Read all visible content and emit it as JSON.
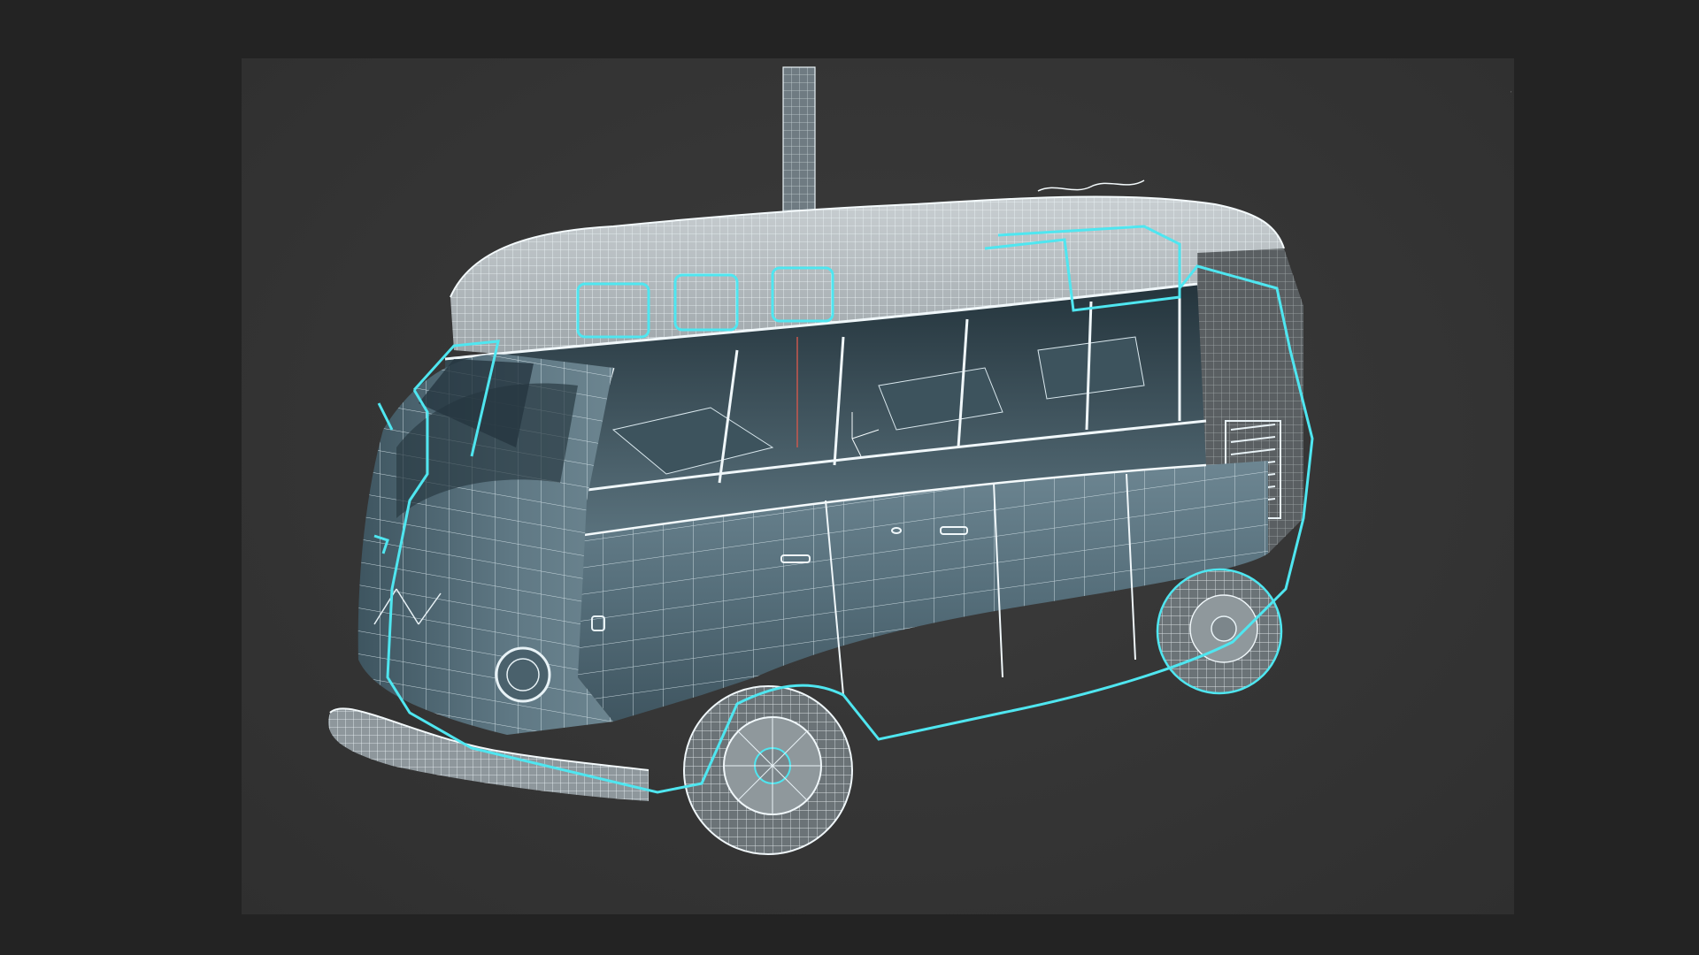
{
  "app": {
    "viewport": {
      "corner_glyph": "ˑ"
    }
  },
  "scene": {
    "object": "wireframe-microbus",
    "selection_color": "#4fe6f0",
    "wire_color": "#e8f2f6",
    "body_color": "#5b7480",
    "background_color": "#383838"
  }
}
